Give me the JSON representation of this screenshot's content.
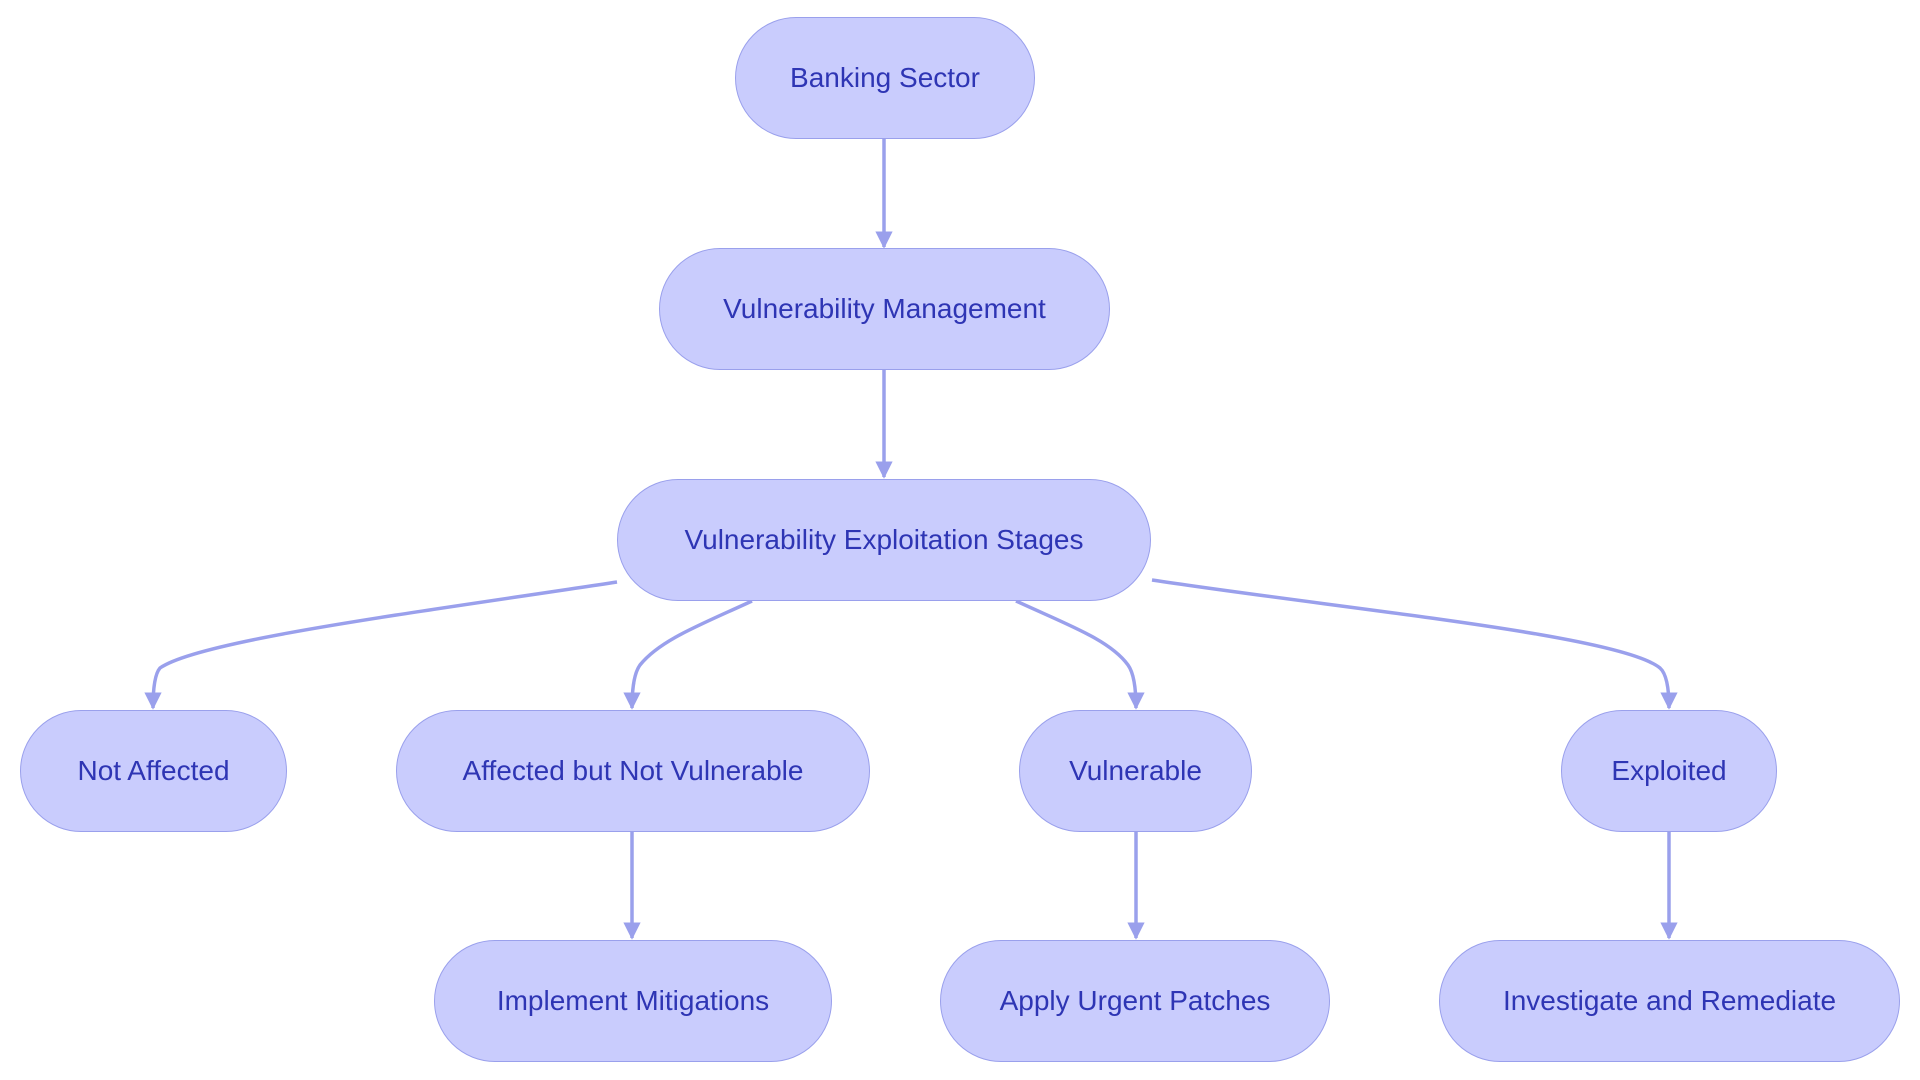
{
  "diagram": {
    "type": "flowchart",
    "colors": {
      "node_fill": "#c9ccfd",
      "node_border": "#9aa0ec",
      "text": "#2e35b4",
      "edge": "#9aa0ec"
    },
    "nodes": [
      {
        "id": "banking",
        "label": "Banking Sector"
      },
      {
        "id": "vm",
        "label": "Vulnerability Management"
      },
      {
        "id": "stages",
        "label": "Vulnerability Exploitation Stages"
      },
      {
        "id": "not_affected",
        "label": "Not Affected"
      },
      {
        "id": "affected_nv",
        "label": "Affected but Not Vulnerable"
      },
      {
        "id": "vulnerable",
        "label": "Vulnerable"
      },
      {
        "id": "exploited",
        "label": "Exploited"
      },
      {
        "id": "mitigations",
        "label": "Implement Mitigations"
      },
      {
        "id": "patches",
        "label": "Apply Urgent Patches"
      },
      {
        "id": "investigate",
        "label": "Investigate and Remediate"
      }
    ],
    "edges": [
      {
        "from": "banking",
        "to": "vm"
      },
      {
        "from": "vm",
        "to": "stages"
      },
      {
        "from": "stages",
        "to": "not_affected"
      },
      {
        "from": "stages",
        "to": "affected_nv"
      },
      {
        "from": "stages",
        "to": "vulnerable"
      },
      {
        "from": "stages",
        "to": "exploited"
      },
      {
        "from": "affected_nv",
        "to": "mitigations"
      },
      {
        "from": "vulnerable",
        "to": "patches"
      },
      {
        "from": "exploited",
        "to": "investigate"
      }
    ]
  }
}
